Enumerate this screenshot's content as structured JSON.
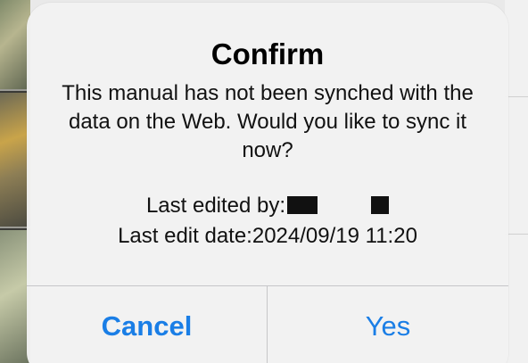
{
  "dialog": {
    "title": "Confirm",
    "message": "This manual has not been synched with the data on the Web. Would you like to sync it now?",
    "last_edited_by_label": "Last edited by:",
    "last_edit_date_label": "Last edit date:",
    "last_edit_date_value": "2024/09/19 11:20",
    "cancel_label": "Cancel",
    "yes_label": "Yes"
  },
  "colors": {
    "accent": "#1a7ee6",
    "dialog_background": "#f2f2f2",
    "separator": "#c6c6c8"
  }
}
